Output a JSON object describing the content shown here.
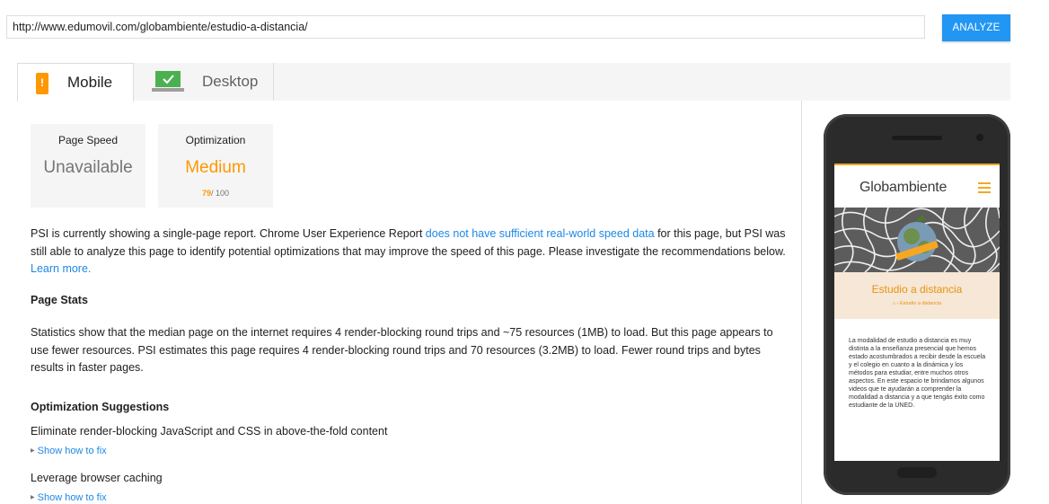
{
  "url_bar": {
    "value": "http://www.edumovil.com/globambiente/estudio-a-distancia/"
  },
  "analyze_label": "ANALYZE",
  "tabs": [
    {
      "label": "Mobile",
      "icon": "mobile-warning-icon",
      "active": true
    },
    {
      "label": "Desktop",
      "icon": "desktop-check-icon",
      "active": false
    }
  ],
  "scores": {
    "speed": {
      "title": "Page Speed",
      "value": "Unavailable"
    },
    "optimization": {
      "title": "Optimization",
      "value": "Medium",
      "score": "79",
      "max": "/ 100",
      "color": "#ff9800"
    }
  },
  "intro": {
    "part1": "PSI is currently showing a single-page report. Chrome User Experience Report ",
    "link1": "does not have sufficient real-world speed data",
    "part2": " for this page, but PSI was still able to analyze this page to identify potential optimizations that may improve the speed of this page. Please investigate the recommendations below. ",
    "link2": "Learn more."
  },
  "stats": {
    "heading": "Page Stats",
    "text": "Statistics show that the median page on the internet requires 4 render-blocking round trips and ~75 resources (1MB) to load. But this page appears to use fewer resources. PSI estimates this page requires 4 render-blocking round trips and 70 resources (3.2MB) to load. Fewer round trips and bytes results in faster pages."
  },
  "suggestions": {
    "heading": "Optimization Suggestions",
    "items": [
      {
        "title": "Eliminate render-blocking JavaScript and CSS in above-the-fold content",
        "link": "Show how to fix"
      },
      {
        "title": "Leverage browser caching",
        "link": "Show how to fix"
      }
    ]
  },
  "phone_preview": {
    "logo": "Globambiente",
    "page_title": "Estudio a distancia",
    "breadcrumb": "Estudio a distancia",
    "body": "La modalidad de estudio a distancia es muy distinta a la enseñanza presencial que hemos estado acostumbrados a recibir desde la escuela y el colegio en cuanto a la dinámica y los métodos para estudiar, entre muchos otros aspectos. En este espacio te brindamos algunos videos que te ayudarán a comprender la modalidad a distancia y a que tengás éxito como estudiante de la UNED."
  },
  "colors": {
    "accent": "#2196f3",
    "link": "#1e88e5",
    "warning": "#ff9800",
    "pass": "#4caf50"
  }
}
